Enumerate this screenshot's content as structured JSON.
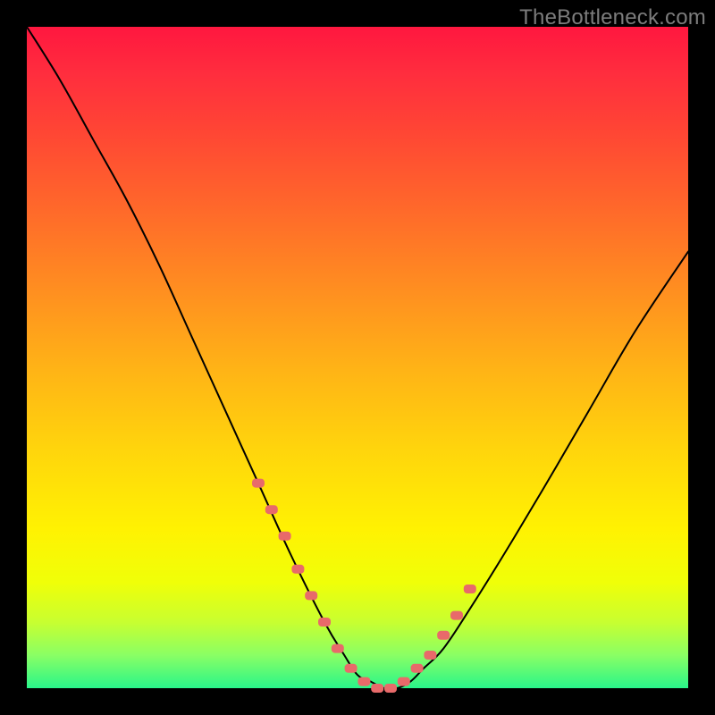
{
  "watermark": "TheBottleneck.com",
  "colors": {
    "background": "#000000",
    "curve_stroke": "#000000",
    "marker_fill": "#e86a6a",
    "gradient_top": "#ff173f",
    "gradient_bottom": "#29f58a"
  },
  "chart_data": {
    "type": "line",
    "title": "",
    "xlabel": "",
    "ylabel": "",
    "xlim": [
      0,
      100
    ],
    "ylim": [
      0,
      100
    ],
    "grid": false,
    "legend": false,
    "series": [
      {
        "name": "curve",
        "comment": "bottleneck-style V curve; values estimated from pixel positions",
        "x": [
          0,
          5,
          10,
          15,
          20,
          25,
          30,
          35,
          40,
          45,
          48,
          50,
          52,
          54,
          56,
          58,
          60,
          63,
          67,
          72,
          78,
          85,
          92,
          100
        ],
        "values": [
          100,
          92,
          83,
          74,
          64,
          53,
          42,
          31,
          20,
          10,
          5,
          2,
          1,
          0,
          0,
          1,
          3,
          6,
          12,
          20,
          30,
          42,
          54,
          66
        ]
      },
      {
        "name": "markers",
        "comment": "salmon dotted segment near the bottom of the V",
        "x": [
          35,
          37,
          39,
          41,
          43,
          45,
          47,
          49,
          51,
          53,
          55,
          57,
          59,
          61,
          63,
          65,
          67
        ],
        "values": [
          31,
          27,
          23,
          18,
          14,
          10,
          6,
          3,
          1,
          0,
          0,
          1,
          3,
          5,
          8,
          11,
          15
        ]
      }
    ]
  }
}
